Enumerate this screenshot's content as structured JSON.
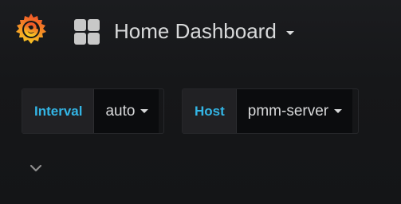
{
  "header": {
    "logo_icon": "grafana-logo-icon",
    "dashboards_icon": "dashboard-grid-icon",
    "title": "Home Dashboard",
    "title_caret_icon": "caret-down-icon"
  },
  "variables": [
    {
      "label": "Interval",
      "value": "auto"
    },
    {
      "label": "Host",
      "value": "pmm-server"
    }
  ],
  "collapse_icon": "chevron-down-icon",
  "colors": {
    "background": "#161719",
    "label_text": "#33b5e5",
    "value_bg": "#0b0c0e",
    "label_bg": "#212124",
    "logo_orange": "#f7821b"
  }
}
